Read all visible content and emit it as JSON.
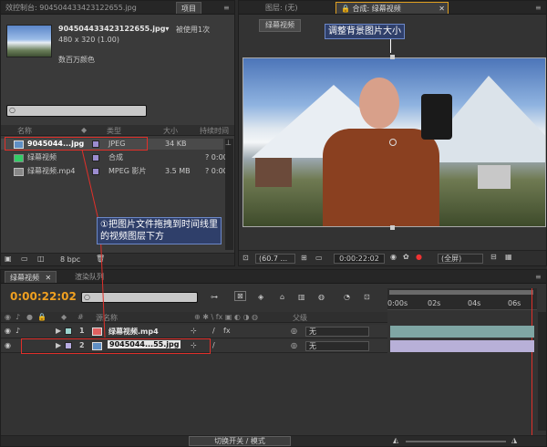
{
  "project_panel": {
    "tab_left": "效控制台: 904504433423122655.jpg",
    "tab_project": "项目",
    "file_name": "904504433423122655.jpg▾",
    "usage": "被使用1次",
    "resolution": "480 x 320 (1.00)",
    "color_depth": "数百万颜色",
    "search_placeholder": "",
    "columns": {
      "name": "名称",
      "type": "类型",
      "size": "大小",
      "duration": "持续时间"
    },
    "items": [
      {
        "name": "9045044...jpg",
        "type": "JPEG",
        "size": "34 KB",
        "duration": "",
        "swatch": "#9b8ccf"
      },
      {
        "name": "绿幕视频",
        "type": "合成",
        "size": "",
        "duration": "? 0:00",
        "swatch": "#9b8ccf"
      },
      {
        "name": "绿幕视频.mp4",
        "type": "MPEG 影片",
        "size": "3.5 MB",
        "duration": "? 0:00",
        "swatch": "#9b8ccf"
      }
    ],
    "bpc": "8 bpc"
  },
  "viewer_panel": {
    "tab_layer": "图层: (无)",
    "tab_comp": "合成: 绿幕视频",
    "comp_button": "绿幕视频",
    "zoom": "(60.7 ...",
    "timecode": "0:00:22:02",
    "resolution": "(全屏)"
  },
  "annotations": {
    "top": "调整背景图片大小",
    "left_line1": "①把图片文件拖拽到时间线里",
    "left_line2": "的视频图层下方"
  },
  "timeline": {
    "tab_comp": "绿幕视频",
    "tab_render": "渲染队列",
    "timecode": "0:00:22:02",
    "col_name": "源名称",
    "col_parent": "父级",
    "ruler": [
      "0:00s",
      "02s",
      "04s",
      "06s"
    ],
    "layers": [
      {
        "num": "1",
        "name": "绿幕视频.mp4",
        "parent": "无"
      },
      {
        "num": "2",
        "name": "9045044...55.jpg",
        "parent": "无"
      }
    ],
    "footer": "切换开关 / 模式"
  },
  "colors": {
    "accent": "#f0a020",
    "highlight": "#e0302a",
    "callout_bg": "#2f3f6a"
  }
}
